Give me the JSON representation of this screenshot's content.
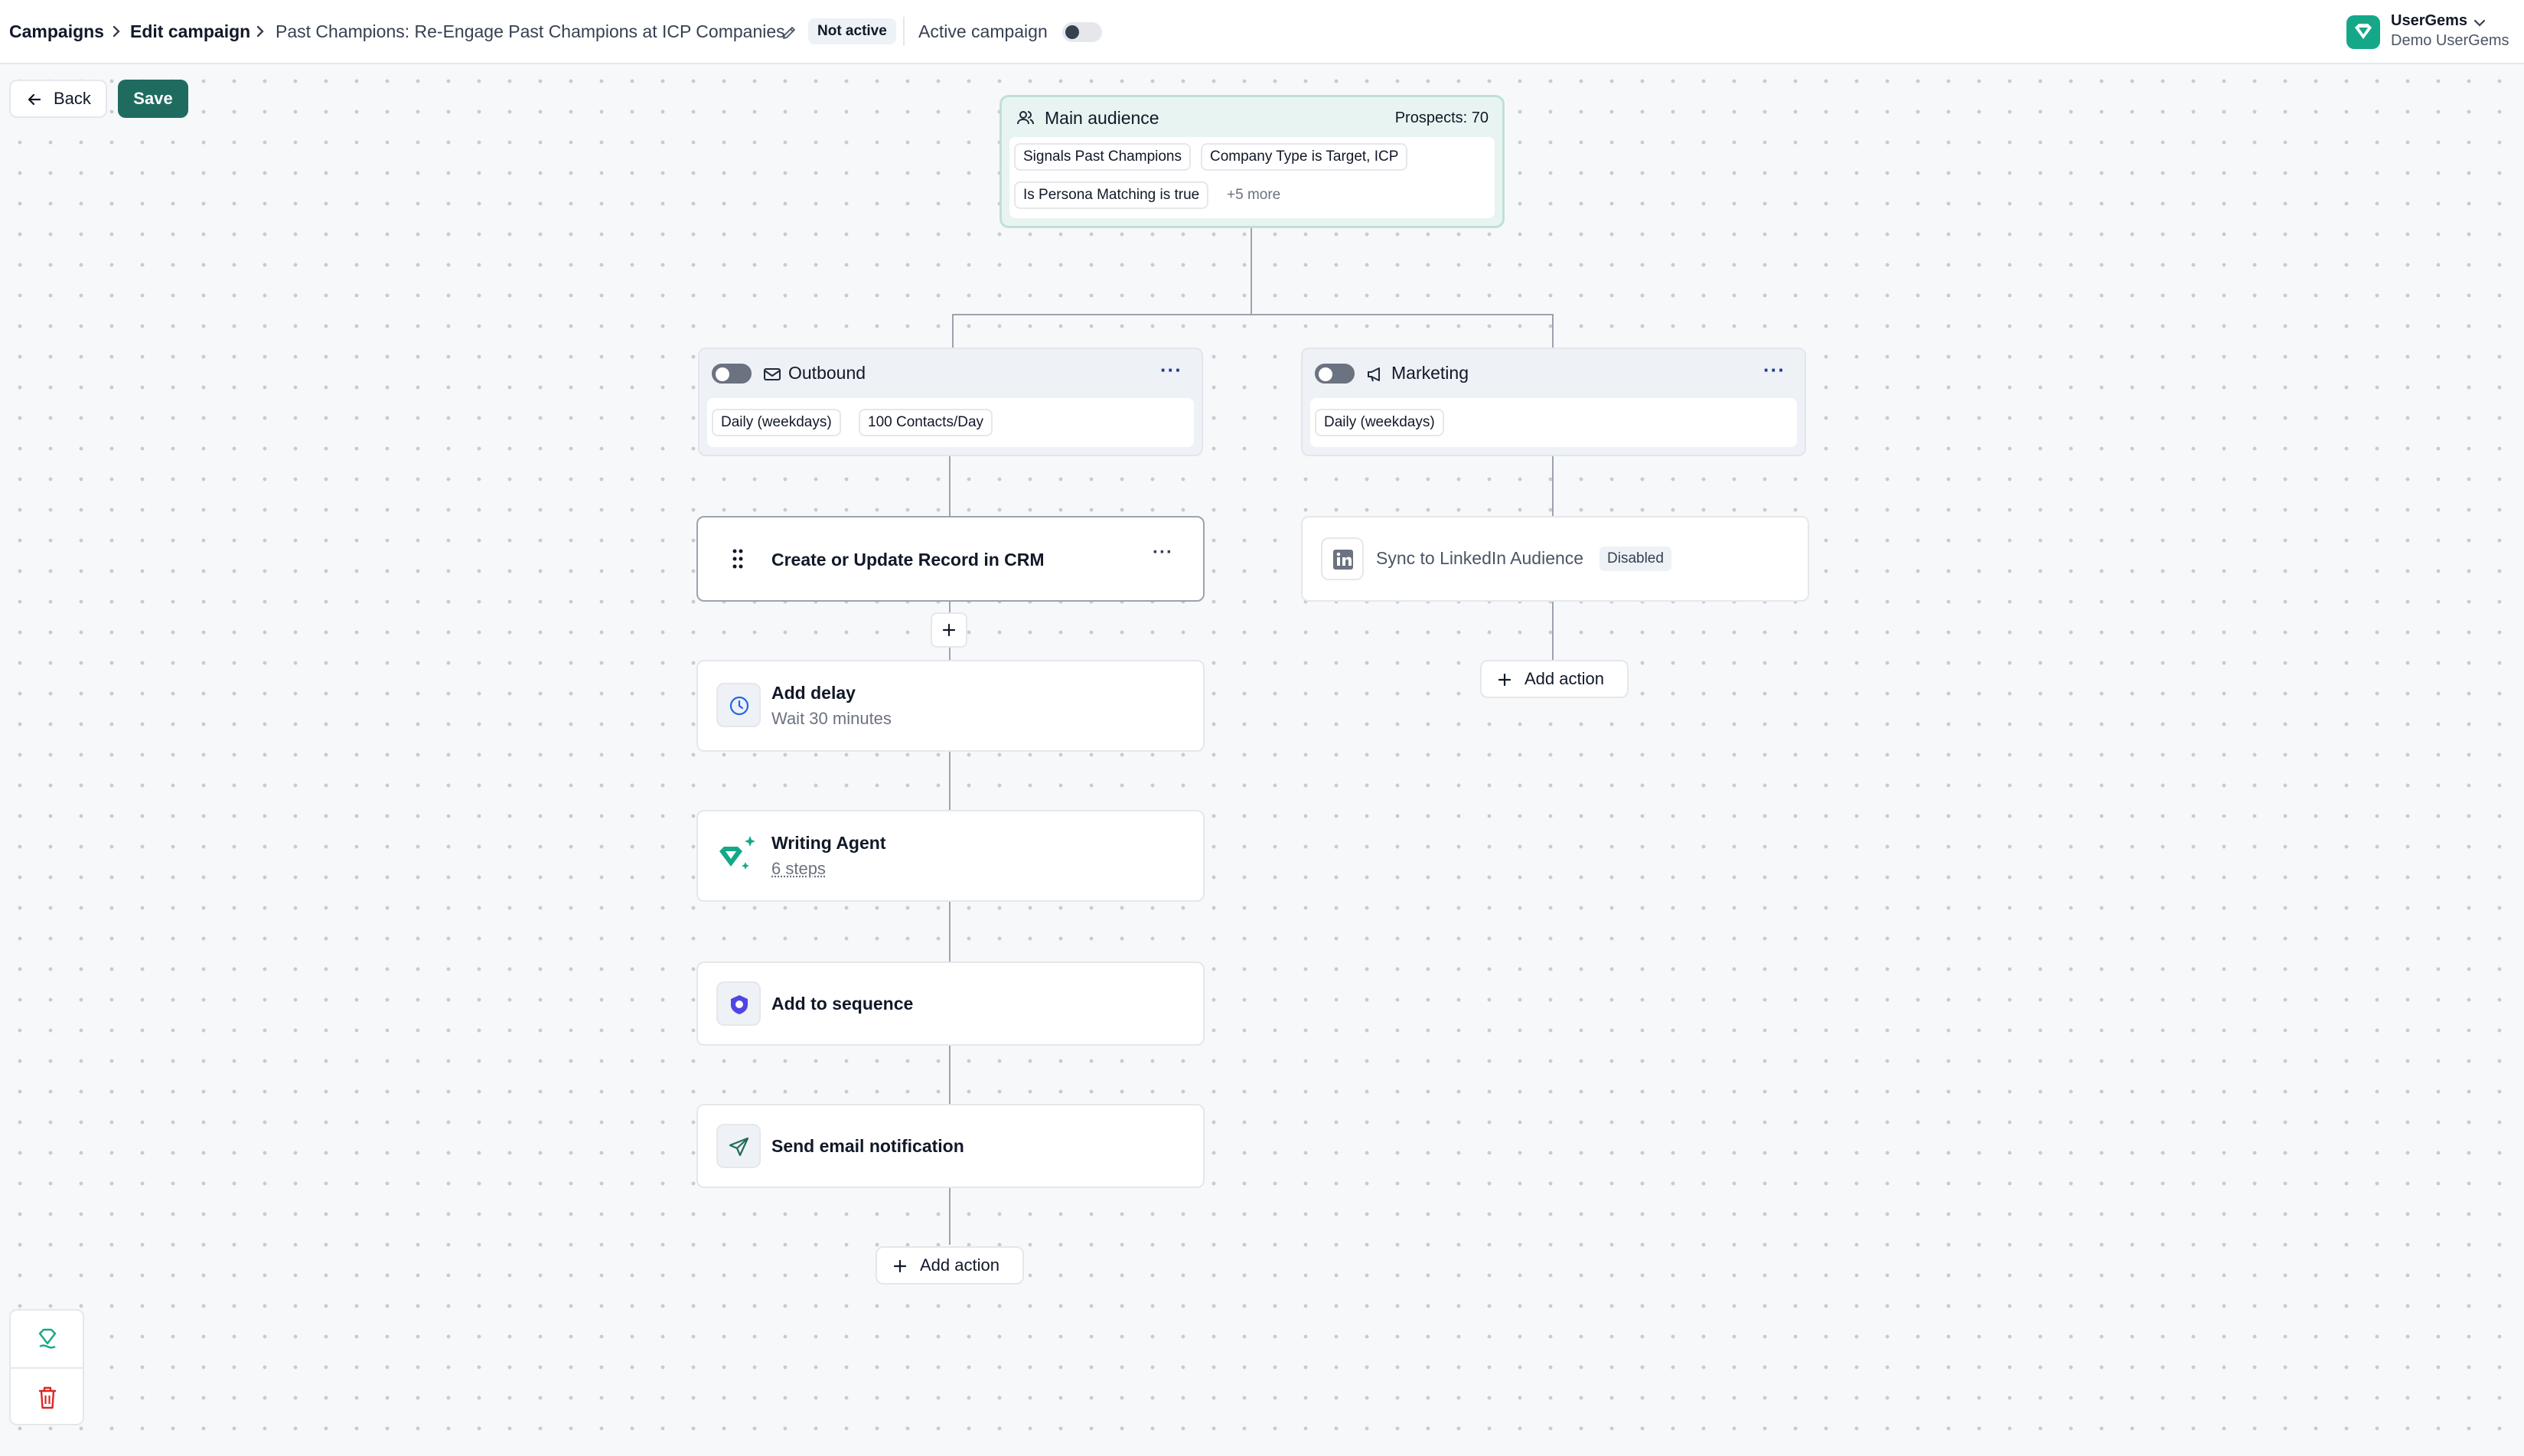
{
  "breadcrumb": {
    "campaigns": "Campaigns",
    "edit_campaign": "Edit campaign",
    "campaign_name": "Past Champions: Re-Engage Past Champions at ICP Companies",
    "status_badge": "Not active",
    "active_label": "Active campaign",
    "active_toggle": false
  },
  "account": {
    "name": "UserGems",
    "org": "Demo UserGems"
  },
  "toolbar": {
    "back_label": "Back",
    "save_label": "Save"
  },
  "audience": {
    "title": "Main audience",
    "prospects": "Prospects: 70",
    "filters": [
      "Signals Past Champions",
      "Company Type is Target, ICP",
      "Is Persona Matching is true"
    ],
    "more": "+5 more"
  },
  "outbound": {
    "title": "Outbound",
    "enabled": false,
    "tags": [
      "Daily (weekdays)",
      "100 Contacts/Day"
    ],
    "steps": [
      {
        "title": "Create or Update Record in CRM"
      },
      {
        "title": "Add delay",
        "subtitle": "Wait 30 minutes"
      },
      {
        "title": "Writing Agent",
        "subtitle": "6 steps"
      },
      {
        "title": "Add to sequence"
      },
      {
        "title": "Send email notification"
      }
    ],
    "add_action": "Add action"
  },
  "marketing": {
    "title": "Marketing",
    "enabled": false,
    "tags": [
      "Daily (weekdays)"
    ],
    "steps": [
      {
        "title": "Sync to LinkedIn Audience",
        "badge": "Disabled"
      }
    ],
    "add_action": "Add action"
  },
  "colors": {
    "brand": "#14a889",
    "save_button": "#1f6b5f",
    "audience_bg": "#e8f4f1",
    "delete": "#dc2626"
  },
  "icons": [
    "chevron-right-icon",
    "pencil-icon",
    "chevron-down-icon",
    "arrow-left-icon",
    "users-icon",
    "mail-icon",
    "megaphone-icon",
    "drag-handle-icon",
    "more-icon",
    "plus-icon",
    "clock-icon",
    "writing-agent-icon",
    "sequence-icon",
    "send-icon",
    "linkedin-icon",
    "usergems-icon",
    "trash-icon"
  ]
}
